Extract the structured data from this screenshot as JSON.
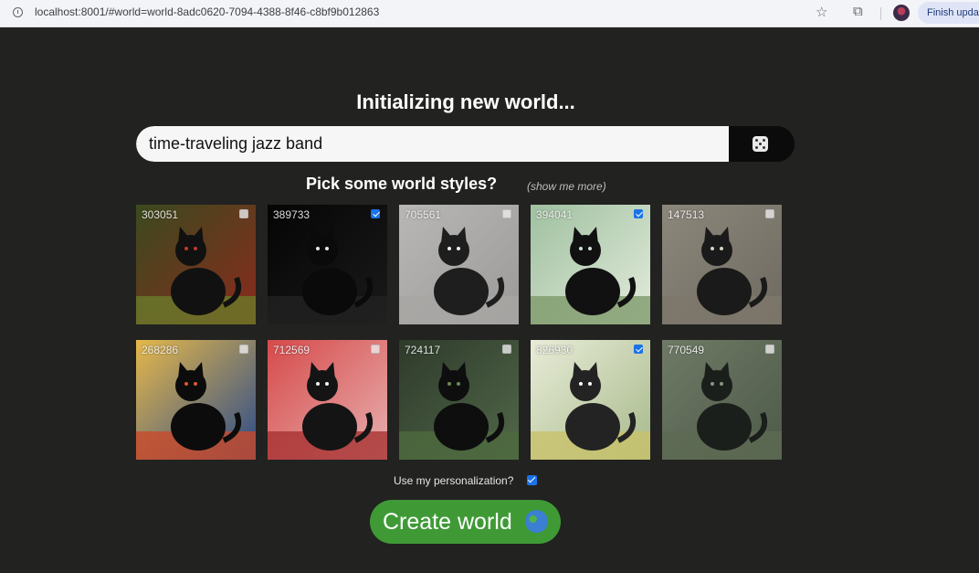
{
  "browser": {
    "url": "localhost:8001/#world=world-8adc0620-7094-4388-8f46-c8bf9b012863",
    "update_button": "Finish upda"
  },
  "page": {
    "heading": "Initializing new world...",
    "prompt_value": "time-traveling jazz band",
    "styles_heading": "Pick some world styles?",
    "show_more": "(show me more)",
    "personalization_label": "Use my personalization?",
    "personalization_checked": true,
    "create_button": "Create world"
  },
  "styles": [
    {
      "id": "303051",
      "checked": false,
      "theme": "grunge"
    },
    {
      "id": "389733",
      "checked": true,
      "theme": "sketch"
    },
    {
      "id": "705561",
      "checked": false,
      "theme": "gray"
    },
    {
      "id": "394041",
      "checked": true,
      "theme": "forest"
    },
    {
      "id": "147513",
      "checked": false,
      "theme": "sepia"
    },
    {
      "id": "268286",
      "checked": false,
      "theme": "bold"
    },
    {
      "id": "712569",
      "checked": false,
      "theme": "red"
    },
    {
      "id": "724117",
      "checked": false,
      "theme": "woods"
    },
    {
      "id": "826930",
      "checked": true,
      "theme": "watercolor"
    },
    {
      "id": "770549",
      "checked": false,
      "theme": "mist"
    }
  ],
  "colors": {
    "background": "#222220",
    "create_button": "#3f9a36",
    "checkbox": "#1a73e8"
  }
}
